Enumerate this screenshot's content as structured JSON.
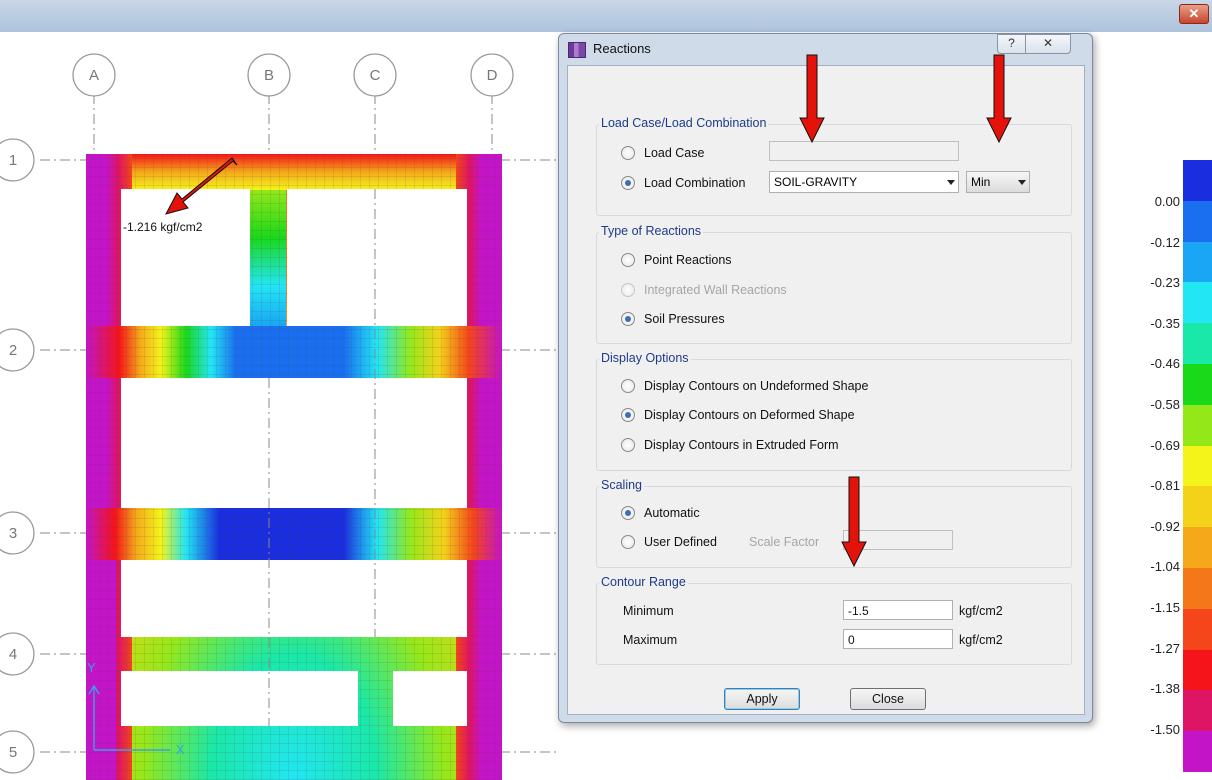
{
  "dialog": {
    "title": "Reactions",
    "help_label": "?",
    "close_x_label": "✕",
    "load_group": {
      "title": "Load Case/Load Combination",
      "load_case_label": "Load Case",
      "load_case_value": "",
      "load_combination_label": "Load Combination",
      "load_combination_value": "SOIL-GRAVITY",
      "min_max_value": "Min",
      "selected": "load_combination"
    },
    "type_group": {
      "title": "Type of Reactions",
      "point_reactions_label": "Point Reactions",
      "integrated_wall_label": "Integrated Wall Reactions",
      "soil_pressures_label": "Soil Pressures",
      "selected": "soil_pressures"
    },
    "display_group": {
      "title": "Display Options",
      "undeformed_label": "Display Contours on Undeformed Shape",
      "deformed_label": "Display Contours on Deformed Shape",
      "extruded_label": "Display Contours in Extruded Form",
      "selected": "deformed"
    },
    "scaling_group": {
      "title": "Scaling",
      "automatic_label": "Automatic",
      "user_defined_label": "User Defined",
      "scale_factor_label": "Scale Factor",
      "scale_factor_value": "",
      "selected": "automatic"
    },
    "contour_group": {
      "title": "Contour Range",
      "minimum_label": "Minimum",
      "minimum_value": "-1.5",
      "maximum_label": "Maximum",
      "maximum_value": "0",
      "unit": "kgf/cm2"
    },
    "apply_label": "Apply",
    "close_label": "Close"
  },
  "model_view": {
    "grid_columns": [
      "A",
      "B",
      "C",
      "D"
    ],
    "grid_rows": [
      "1",
      "2",
      "3",
      "4",
      "5"
    ],
    "value_label": "-1.216 kgf/cm2",
    "axis_x": "X",
    "axis_y": "Y"
  },
  "legend": {
    "ticks": [
      "0.00",
      "-0.12",
      "-0.23",
      "-0.35",
      "-0.46",
      "-0.58",
      "-0.69",
      "-0.81",
      "-0.92",
      "-1.04",
      "-1.15",
      "-1.27",
      "-1.38",
      "-1.50"
    ],
    "colors": [
      "#1a2ee0",
      "#1a6ef0",
      "#1aa6f4",
      "#22e6f4",
      "#1ae8a8",
      "#1ad81a",
      "#94e81a",
      "#f4f41a",
      "#f4d21a",
      "#f4a81a",
      "#f4781a",
      "#f4461a",
      "#f4141a",
      "#de1464",
      "#c414c8"
    ]
  },
  "colors": {
    "arrow_red": "#e3120b",
    "dialog_frame": "#cfdbe9",
    "group_title": "#1e3a8a"
  }
}
